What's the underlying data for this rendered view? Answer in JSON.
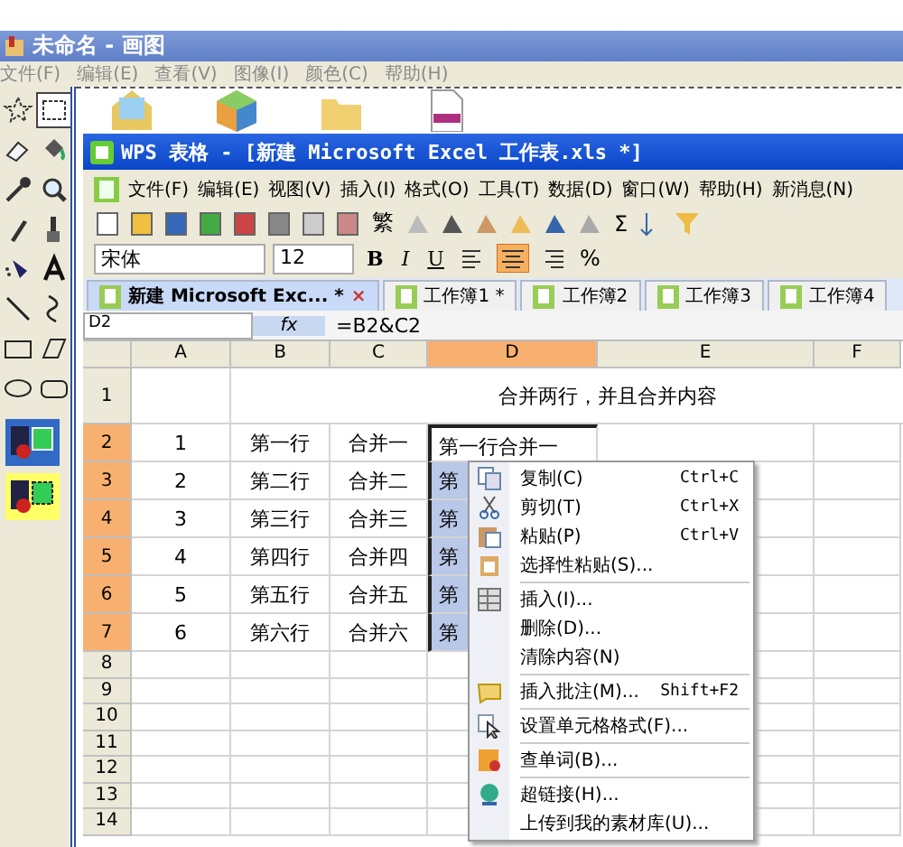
{
  "paint": {
    "title": "未命名 - 画图",
    "menus": [
      "文件(F)",
      "编辑(E)",
      "查看(V)",
      "图像(I)",
      "颜色(C)",
      "帮助(H)"
    ]
  },
  "wps": {
    "title": "WPS 表格 - [新建 Microsoft Excel 工作表.xls *]",
    "menus": [
      "文件(F)",
      "编辑(E)",
      "视图(V)",
      "插入(I)",
      "格式(O)",
      "工具(T)",
      "数据(D)",
      "窗口(W)",
      "帮助(H)",
      "新消息(N)"
    ],
    "toolbar_text": "繁",
    "font": "宋体",
    "font_size": "12",
    "format_buttons": [
      {
        "label": "B",
        "selected": false
      },
      {
        "label": "I",
        "selected": false
      },
      {
        "label": "U",
        "selected": false
      }
    ],
    "align_buttons": [
      {
        "selected": false
      },
      {
        "selected": true
      },
      {
        "selected": false
      }
    ],
    "percent": "%",
    "sigma": "Σ",
    "tabs": [
      {
        "label": "新建 Microsoft Exc... *",
        "selected": true,
        "close": "×"
      },
      {
        "label": "工作簿1 *",
        "selected": false
      },
      {
        "label": "工作簿2",
        "selected": false
      },
      {
        "label": "工作簿3",
        "selected": false
      },
      {
        "label": "工作簿4",
        "selected": false
      }
    ],
    "name_box": "D2",
    "fx": "fx",
    "formula": "=B2&C2",
    "columns": [
      {
        "label": "A",
        "selected": false
      },
      {
        "label": "B",
        "selected": false
      },
      {
        "label": "C",
        "selected": false
      },
      {
        "label": "D",
        "selected": true
      },
      {
        "label": "E",
        "selected": false
      },
      {
        "label": "F",
        "selected": false
      }
    ],
    "rows": [
      {
        "header": "1",
        "selected": false,
        "kind": "merged",
        "text": "合并两行，并且合并内容"
      },
      {
        "header": "2",
        "selected": true,
        "kind": "cells",
        "cells": [
          "1",
          "第一行",
          "合并一",
          "第一行合并一"
        ]
      },
      {
        "header": "3",
        "selected": true,
        "kind": "cells",
        "cells": [
          "2",
          "第二行",
          "合并二",
          "第"
        ]
      },
      {
        "header": "4",
        "selected": true,
        "kind": "cells",
        "cells": [
          "3",
          "第三行",
          "合并三",
          "第"
        ]
      },
      {
        "header": "5",
        "selected": true,
        "kind": "cells",
        "cells": [
          "4",
          "第四行",
          "合并四",
          "第"
        ]
      },
      {
        "header": "6",
        "selected": true,
        "kind": "cells",
        "cells": [
          "5",
          "第五行",
          "合并五",
          "第"
        ]
      },
      {
        "header": "7",
        "selected": true,
        "kind": "cells",
        "cells": [
          "6",
          "第六行",
          "合并六",
          "第"
        ]
      },
      {
        "header": "8",
        "selected": false,
        "kind": "empty"
      },
      {
        "header": "9",
        "selected": false,
        "kind": "empty"
      },
      {
        "header": "10",
        "selected": false,
        "kind": "empty"
      },
      {
        "header": "11",
        "selected": false,
        "kind": "empty"
      },
      {
        "header": "12",
        "selected": false,
        "kind": "empty"
      },
      {
        "header": "13",
        "selected": false,
        "kind": "empty"
      },
      {
        "header": "14",
        "selected": false,
        "kind": "empty"
      }
    ],
    "context_menu": [
      {
        "kind": "item",
        "label": "复制(C)",
        "shortcut": "Ctrl+C"
      },
      {
        "kind": "item",
        "label": "剪切(T)",
        "shortcut": "Ctrl+X"
      },
      {
        "kind": "item",
        "label": "粘贴(P)",
        "shortcut": "Ctrl+V"
      },
      {
        "kind": "item",
        "label": "选择性粘贴(S)..."
      },
      {
        "kind": "separator"
      },
      {
        "kind": "item",
        "label": "插入(I)..."
      },
      {
        "kind": "item",
        "label": "删除(D)..."
      },
      {
        "kind": "item",
        "label": "清除内容(N)"
      },
      {
        "kind": "separator"
      },
      {
        "kind": "item",
        "label": "插入批注(M)...",
        "shortcut": "Shift+F2"
      },
      {
        "kind": "separator"
      },
      {
        "kind": "item",
        "label": "设置单元格格式(F)..."
      },
      {
        "kind": "separator"
      },
      {
        "kind": "item",
        "label": "查单词(B)..."
      },
      {
        "kind": "separator"
      },
      {
        "kind": "item",
        "label": "超链接(H)..."
      },
      {
        "kind": "item",
        "label": "上传到我的素材库(U)..."
      }
    ]
  }
}
